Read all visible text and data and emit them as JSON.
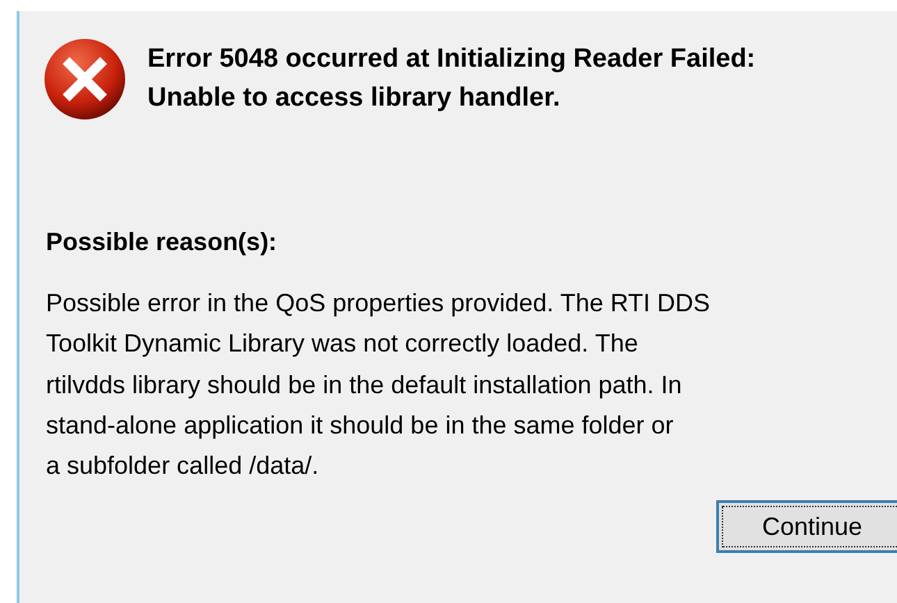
{
  "dialog": {
    "message_lines": [
      "Error 5048 occurred at Initializing Reader Failed:",
      "Unable to access library handler."
    ],
    "reason_heading": "Possible reason(s):",
    "reason_lines": [
      "Possible error in the QoS properties provided. The RTI DDS",
      "Toolkit Dynamic Library was not correctly loaded. The",
      "rtilvdds library should be in the default installation path. In",
      "stand-alone application it should be in the same folder or",
      "a subfolder called /data/."
    ],
    "buttons": [
      {
        "label": "Continue",
        "focused": true
      }
    ]
  }
}
